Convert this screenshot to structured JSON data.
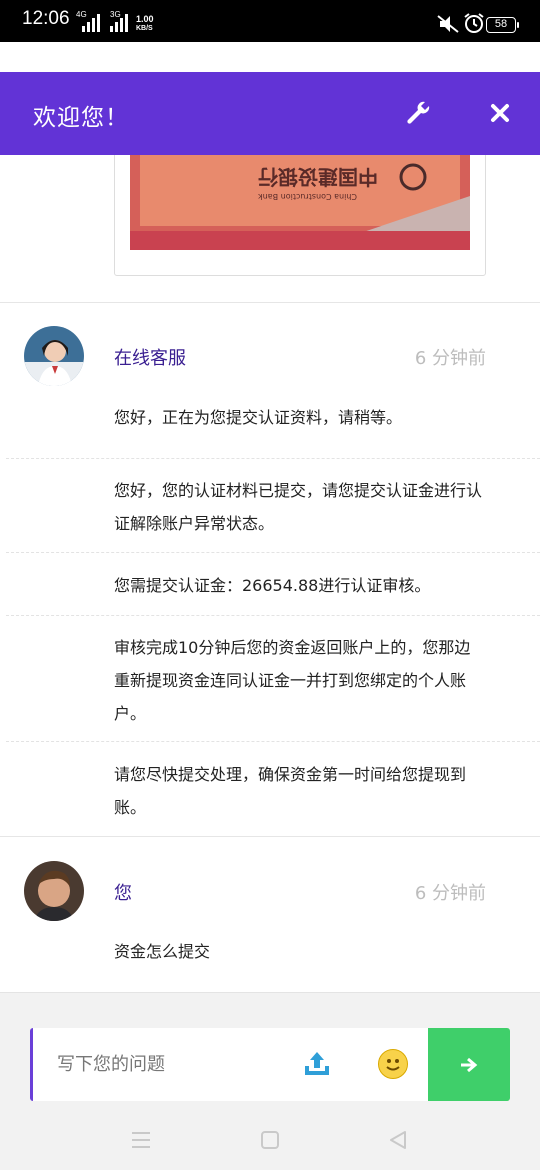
{
  "status_bar": {
    "time": "12:06",
    "net_1": "4G",
    "net_2": "3G",
    "speed_value": "1.00",
    "speed_unit": "KB/S",
    "battery": "58"
  },
  "header": {
    "title": "欢迎您！",
    "settings_icon": "wrench-icon",
    "close_icon": "close-icon",
    "background": "#6233d6"
  },
  "image_message": {
    "card_text_bank": "中国建设银行",
    "card_text_en": "China Construction Bank"
  },
  "messages": [
    {
      "sender": "在线客服",
      "time": "6 分钟前",
      "avatar": "agent-avatar",
      "lines": [
        "您好，正在为您提交认证资料，请稍等。",
        "您好，您的认证材料已提交，请您提交认证金进行认证解除账户异常状态。",
        "您需提交认证金：26654.88进行认证审核。",
        "审核完成10分钟后您的资金返回账户上的，您那边重新提现资金连同认证金一并打到您绑定的个人账户。",
        "请您尽快提交处理，确保资金第一时间给您提现到账。"
      ]
    },
    {
      "sender": "您",
      "time": "6 分钟前",
      "avatar": "user-avatar",
      "lines": [
        "资金怎么提交"
      ]
    }
  ],
  "composer": {
    "placeholder": "写下您的问题",
    "upload_icon": "upload-icon",
    "emoji_icon": "smiley-icon",
    "send_icon": "arrow-right-icon",
    "accent": "#6a3fd8",
    "send_color": "#3fcf6a"
  },
  "nav": {
    "menu_icon": "menu-icon",
    "home_icon": "square-icon",
    "back_icon": "back-triangle-icon"
  }
}
